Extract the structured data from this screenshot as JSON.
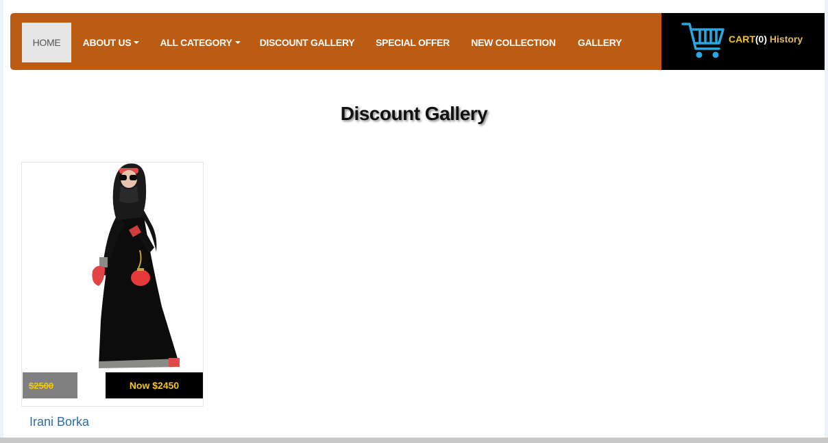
{
  "nav": {
    "items": [
      {
        "label": "HOME",
        "active": true
      },
      {
        "label": "ABOUT US",
        "dropdown": true
      },
      {
        "label": "ALL CATEGORY",
        "dropdown": true
      },
      {
        "label": "DISCOUNT GALLERY"
      },
      {
        "label": "SPECIAL OFFER"
      },
      {
        "label": "NEW COLLECTION"
      },
      {
        "label": "GALLERY"
      }
    ],
    "bar_color": "#bb5c12"
  },
  "cart": {
    "icon": "shopping-cart-icon",
    "label": "CART",
    "count": "(0)",
    "history": "History",
    "icon_color": "#29a8e0"
  },
  "page": {
    "title": "Discount Gallery"
  },
  "products": [
    {
      "name": "Irani Borka",
      "old_price": "$2500",
      "new_price": "Now $2450"
    }
  ]
}
